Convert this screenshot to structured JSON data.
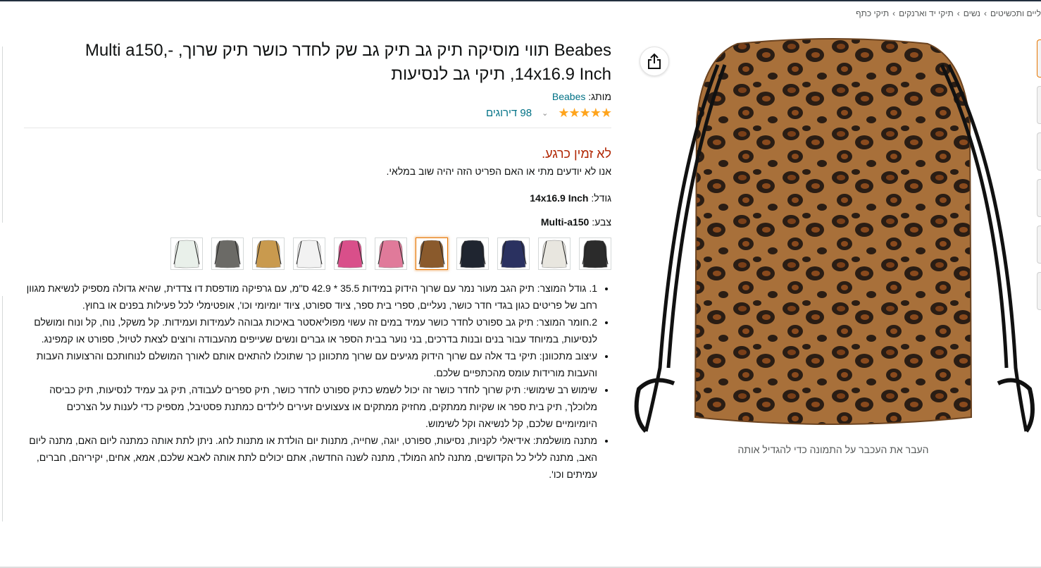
{
  "breadcrumb": [
    "ליים ותכשיטים",
    "נשים",
    "תיקי יד וארנקים",
    "תיקי כתף"
  ],
  "product": {
    "title": "Beabes תווי מוסיקה תיק גב תיק גב שק לחדר כושר תיק שרוך, -Multi a150, 14x16.9 Inch, תיקי גב לנסיעות",
    "brand_prefix": "מותג:",
    "brand": "Beabes",
    "stars": "★★★★★",
    "rating_count": "98 דירוגים",
    "availability": "לא זמין כרגע.",
    "availability_note": "אנו לא יודעים מתי או האם הפריט הזה יהיה שוב במלאי.",
    "size_label": "גודל:",
    "size_value": "14x16.9 Inch",
    "color_label": "צבע:",
    "color_value": "Multi-a150"
  },
  "image_caption": "העבר את העכבר על התמונה כדי להגדיל אותה",
  "swatches": [
    {
      "name": "music-notes",
      "bg": "#2b2b2b"
    },
    {
      "name": "cats",
      "bg": "#e8e6df"
    },
    {
      "name": "space-cats",
      "bg": "#2a3160"
    },
    {
      "name": "dark-pattern",
      "bg": "#1f2530"
    },
    {
      "name": "leopard",
      "bg": "#8a5a2c"
    },
    {
      "name": "pink-marble",
      "bg": "#e07a9a"
    },
    {
      "name": "tie-dye",
      "bg": "#d94f8a"
    },
    {
      "name": "sketch",
      "bg": "#f2f2f2"
    },
    {
      "name": "african-woman",
      "bg": "#c99a4e"
    },
    {
      "name": "pug",
      "bg": "#6b6a66"
    },
    {
      "name": "pineapples",
      "bg": "#e9f0ea"
    }
  ],
  "bullets": [
    "1. גודל המוצר: תיק הגב מעור נמר עם שרוך הידוק במידות 35.5 * 42.9 ס\"מ, עם גרפיקה מודפסת דו צדדית, שהיא גדולה מספיק לנשיאת מגוון רחב של פריטים כגון בגדי חדר כושר, נעליים, ספרי בית ספר, ציוד ספורט, ציוד יומיומי וכו', אופטימלי לכל פעילות בפנים או בחוץ.",
    "2.חומר המוצר: תיק גב ספורט לחדר כושר עמיד במים זה עשוי מפוליאסטר באיכות גבוהה לעמידות ועמידות. קל משקל, נוח, קל ונוח ומושלם לנסיעות, במיוחד עבור בנים ובנות בדרכים, בני נוער בבית הספר או גברים ונשים שעייפים מהעבודה ורוצים לצאת לטיול, ספורט או קמפינג.",
    "עיצוב מתכוונן: תיקי בד אלה עם שרוך הידוק מגיעים עם שרוך מתכוונן כך שתוכלו להתאים אותם לאורך המושלם לנוחותכם והרצועות העבות והעבות מורידות עומס מהכתפיים שלכם.",
    "שימוש רב שימושי: תיק שרוך לחדר כושר זה יכול לשמש כתיק ספורט לחדר כושר, תיק ספרים לעבודה, תיק גב עמיד לנסיעות, תיק כביסה מלוכלך, תיק בית ספר או שקיות ממתקים, מחזיק ממתקים או צעצועים זעירים לילדים כמתנת פסטיבל, מספיק כדי לענות על הצרכים היומיומיים שלכם, קל לנשיאה וקל לשימוש.",
    "מתנה מושלמת: אידיאלי לקניות, נסיעות, ספורט, יוגה, שחייה, מתנות יום הולדת או מתנות לחג. ניתן לתת אותה כמתנה ליום האם, מתנה ליום האב, מתנה לליל כל הקדושים, מתנה לחג המולד, מתנה לשנה החדשה, אתם יכולים לתת אותה לאבא שלכם, אמא, אחים, יקיריהם, חברים, עמיתים וכו'."
  ]
}
